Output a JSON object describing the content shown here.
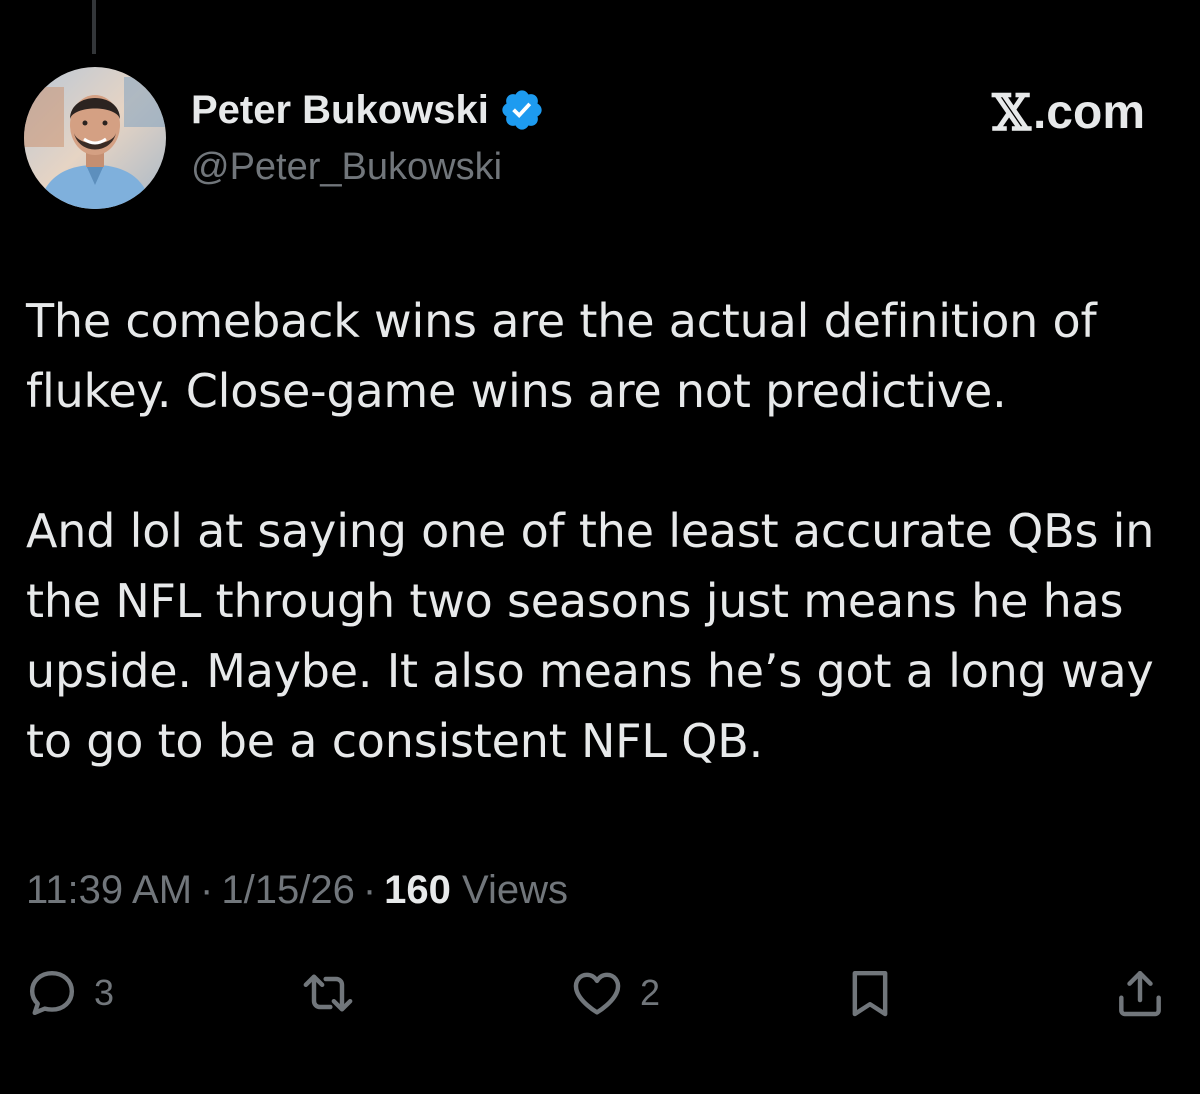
{
  "author": {
    "display_name": "Peter Bukowski",
    "handle": "@Peter_Bukowski",
    "verified": true
  },
  "brand": {
    "label": ".com",
    "x_glyph": "𝕏"
  },
  "tweet": {
    "paragraphs": [
      "The comeback wins are the actual definition of flukey. Close-game wins are not predictive.",
      "And lol at saying one of the least accurate QBs in the NFL through two seasons just means he has upside. Maybe. It also means he’s got a long way to go to be a consistent NFL QB."
    ]
  },
  "meta": {
    "time": "11:39 AM",
    "separator": "·",
    "date": "1/15/26",
    "views_count": "160",
    "views_label": "Views"
  },
  "actions": {
    "reply_count": "3",
    "like_count": "2",
    "icons": [
      "reply-icon",
      "retweet-icon",
      "like-icon",
      "bookmark-icon",
      "share-icon"
    ]
  },
  "colors": {
    "background": "#000000",
    "text": "#e7e9ea",
    "secondary": "#71767b",
    "verified": "#1d9bf0"
  }
}
